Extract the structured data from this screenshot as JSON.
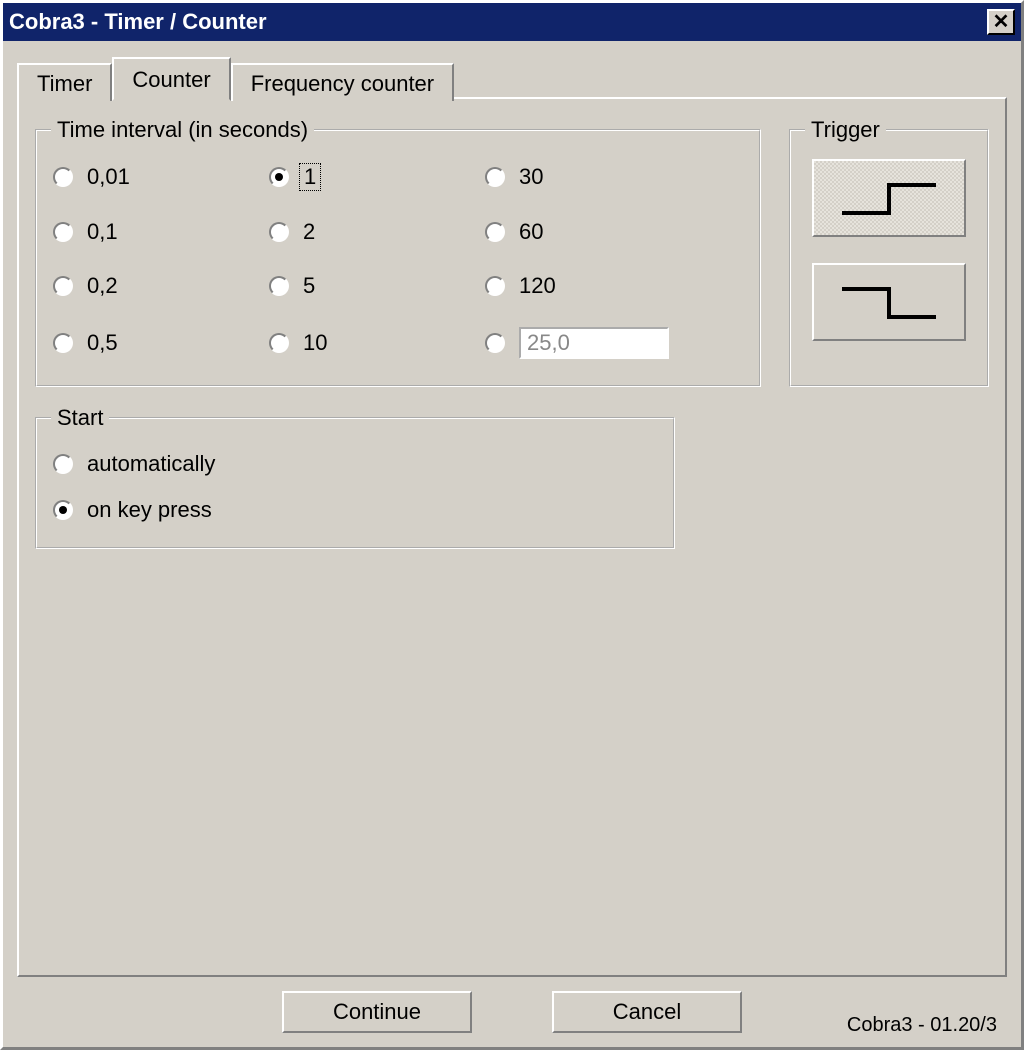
{
  "window": {
    "title": "Cobra3 - Timer / Counter"
  },
  "tabs": {
    "timer": "Timer",
    "counter": "Counter",
    "frequency": "Frequency counter",
    "active": "counter"
  },
  "time_interval": {
    "legend": "Time interval (in seconds)",
    "options": [
      "0,01",
      "0,1",
      "0,2",
      "0,5",
      "1",
      "2",
      "5",
      "10",
      "30",
      "60",
      "120"
    ],
    "selected": "1",
    "custom_value": "25,0"
  },
  "start": {
    "legend": "Start",
    "options": {
      "auto": "automatically",
      "key": "on key press"
    },
    "selected": "key"
  },
  "trigger": {
    "legend": "Trigger",
    "selected": "rising"
  },
  "buttons": {
    "continue": "Continue",
    "cancel": "Cancel"
  },
  "version": "Cobra3 - 01.20/3"
}
